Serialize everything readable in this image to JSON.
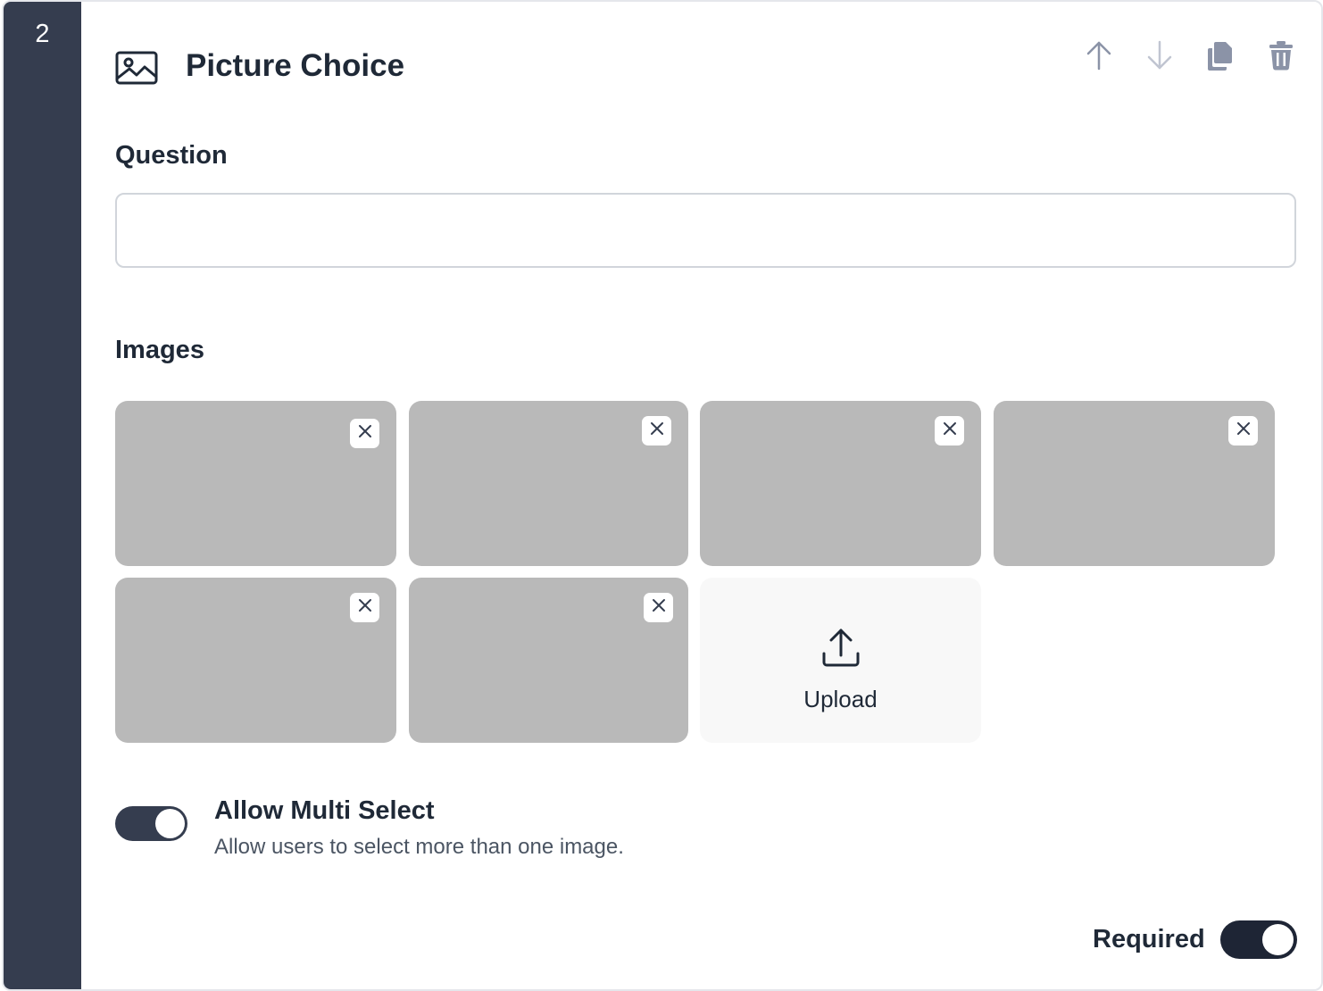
{
  "question_number": "2",
  "header": {
    "icon": "image-icon",
    "title": "Picture Choice",
    "actions": [
      {
        "name": "move-up",
        "icon": "arrow-up-icon"
      },
      {
        "name": "move-down",
        "icon": "arrow-down-icon"
      },
      {
        "name": "duplicate",
        "icon": "copy-icon"
      },
      {
        "name": "delete",
        "icon": "trash-icon"
      }
    ]
  },
  "question": {
    "label": "Question",
    "value": "",
    "placeholder": ""
  },
  "images": {
    "label": "Images",
    "count": 6,
    "upload_label": "Upload"
  },
  "multi_select": {
    "title": "Allow Multi Select",
    "description": "Allow users to select more than one image.",
    "enabled": true
  },
  "required": {
    "label": "Required",
    "enabled": true
  },
  "colors": {
    "rail": "#353d4f",
    "thumbnail": "#b9b9b9",
    "toggle_on": "#353d4f",
    "action_icon": "#8b93a7"
  }
}
